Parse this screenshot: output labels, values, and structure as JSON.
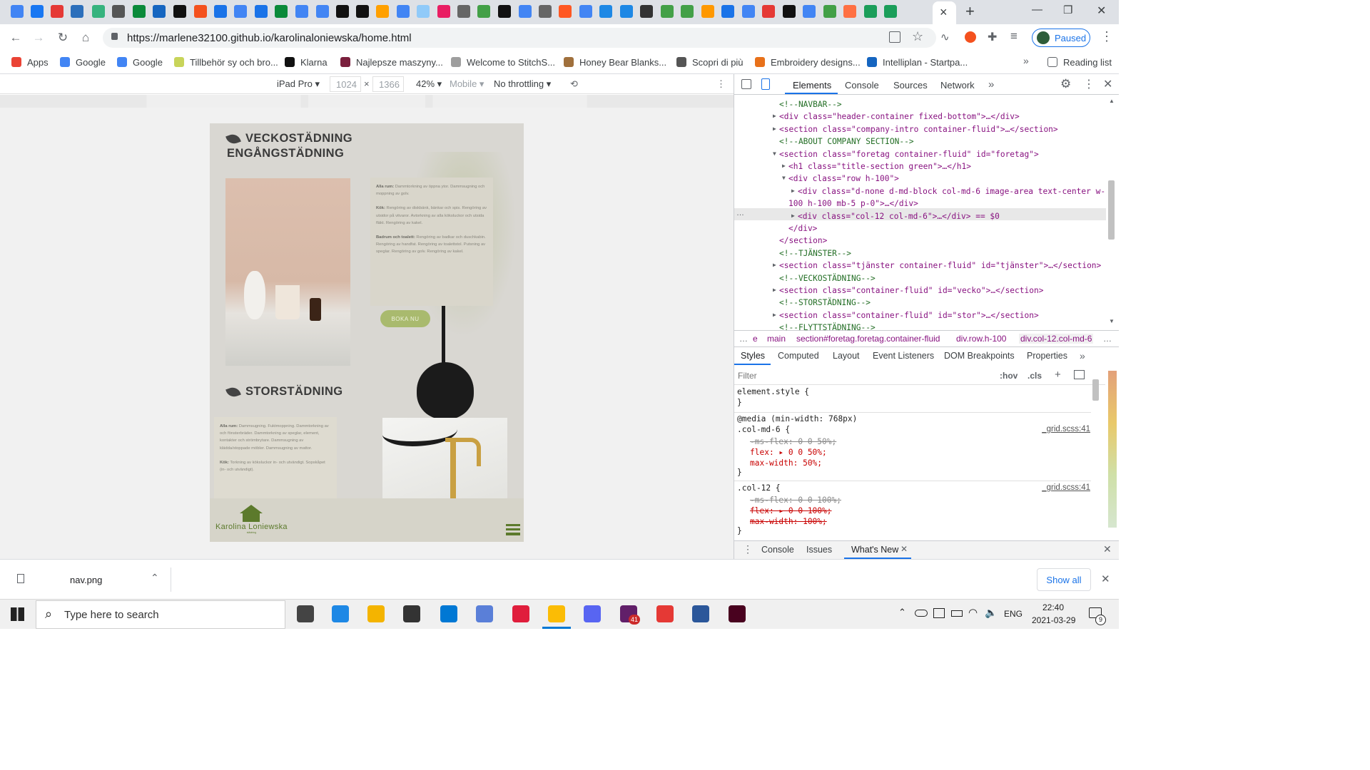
{
  "browser": {
    "active_tab_close": "×",
    "new_tab": "+",
    "url": "https://marlene32100.github.io/karolinaloniewska/home.html",
    "profile_label": "Paused",
    "window_controls": {
      "minimize": "—",
      "maximize": "❐",
      "close": "✕"
    }
  },
  "bookmarks": {
    "items": [
      {
        "label": "Apps",
        "color": "#ea4335"
      },
      {
        "label": "Google",
        "color": "#4285f4"
      },
      {
        "label": "Google",
        "color": "#4285f4"
      },
      {
        "label": "Tillbehör sy och bro...",
        "color": "#c8d45a"
      },
      {
        "label": "Klarna",
        "color": "#111111"
      },
      {
        "label": "Najlepsze maszyny...",
        "color": "#7a1f3d"
      },
      {
        "label": "Welcome to StitchS...",
        "color": "#9e9e9e"
      },
      {
        "label": "Honey Bear Blanks...",
        "color": "#a0703c"
      },
      {
        "label": "Scopri di più",
        "color": "#555555"
      },
      {
        "label": "Embroidery designs...",
        "color": "#e8711a"
      },
      {
        "label": "Intelliplan - Startpa...",
        "color": "#1565c0"
      }
    ],
    "overflow": "»",
    "reading_list": "Reading list"
  },
  "device_toolbar": {
    "device": "iPad Pro",
    "width": "1024",
    "height": "1366",
    "times": "×",
    "zoom": "42%",
    "mobile": "Mobile",
    "throttling": "No throttling"
  },
  "site": {
    "section1_title_1": "VECKOSTÄDNING",
    "section1_title_2": "ENGÅNGSTÄDNING",
    "card1_lines": [
      {
        "bold": "Alla rum:",
        "text": " Dammtorkning av öppna ytor. Dammsugning och moppning av golv."
      },
      {
        "bold": "",
        "text": ""
      },
      {
        "bold": "Kök:",
        "text": " Rengöring av diskbänk, bänkar och spis. Rengöring av utsidor på vitvaror. Avtorkning av alla köksluckor och utsida fläkt. Rengöring av kakel."
      },
      {
        "bold": "",
        "text": ""
      },
      {
        "bold": "Badrum och toalett:",
        "text": " Rengöring av badkar och duschkabin. Rengöring av handfat. Rengöring av toalettstol. Putsning av speglar. Rengöring av golv. Rengöring av kakel."
      }
    ],
    "book_button": "BOKA NU",
    "section2_title": "STORSTÄDNING",
    "card2_lines": [
      {
        "bold": "Alla rum:",
        "text": " Dammsugning. Fuktmoppning. Dammtorkning av och fönsterbräder. Dammtorkning av speglar, element, kontakter och strömbrytare. Dammsugning av klädda/stoppade möbler. Dammsugning av mattor."
      },
      {
        "bold": "",
        "text": ""
      },
      {
        "bold": "Kök:",
        "text": " Torkning av köksluckor in- och utvändigt. Sopskåpet (in- och utvändigt)."
      }
    ],
    "brand_name": "Karolina Loniewska",
    "brand_sub": "städning",
    "accent_green": "#9db05a",
    "dark_green": "#5c7a2c"
  },
  "devtools": {
    "tabs": [
      "Elements",
      "Console",
      "Sources",
      "Network"
    ],
    "more": "»",
    "code_lines": [
      "<!--NAVBAR-->",
      "<div class=\"header-container fixed-bottom\">…</div>",
      "<section class=\"company-intro container-fluid\">…</section>",
      "<!--ABOUT COMPANY SECTION-->",
      "<section class=\"foretag container-fluid\" id=\"foretag\">",
      "<h1 class=\"title-section green\">…</h1>",
      "<div class=\"row h-100\">",
      "<div class=\"d-none d-md-block col-md-6 image-area text-center w-",
      "100 h-100 mb-5 p-0\">…</div>",
      "<div class=\"col-12 col-md-6\">…</div> == $0",
      "</div>",
      "</section>",
      "<!--TJÄNSTER-->",
      "<section class=\"tjänster container-fluid\" id=\"tjänster\">…</section>",
      "<!--VECKOSTÄDNING-->",
      "<section class=\"container-fluid\" id=\"vecko\">…</section>",
      "<!--STORSTÄDNING-->",
      "<section class=\"container-fluid\" id=\"stor\">…</section>",
      "<!--FLYTTSTÄDNING-->"
    ],
    "breadcrumbs": [
      "…",
      "e",
      "main",
      "section#foretag.foretag.container-fluid",
      "div.row.h-100",
      "div.col-12.col-md-6",
      "…"
    ],
    "style_tabs": [
      "Styles",
      "Computed",
      "Layout",
      "Event Listeners",
      "DOM Breakpoints",
      "Properties"
    ],
    "filter_placeholder": "Filter",
    "hov": ":hov",
    "cls": ".cls",
    "styles": {
      "element_style": "element.style {",
      "close_brace": "}",
      "media": "@media (min-width: 768px)",
      "rule1_selector": ".col-md-6 {",
      "rule1_source": "_grid.scss:41",
      "rule1_props": [
        "-ms-flex: 0 0 50%;",
        "flex: ▸ 0 0 50%;",
        "max-width: 50%;"
      ],
      "rule2_selector": ".col-12 {",
      "rule2_source": "_grid.scss:41",
      "rule2_props": [
        "-ms-flex: 0 0 100%;",
        "flex: ▸ 0 0 100%;",
        "max-width: 100%;"
      ]
    },
    "drawer_tabs": [
      "Console",
      "Issues",
      "What's New"
    ]
  },
  "download_bar": {
    "file": "nav.png",
    "show_all": "Show all"
  },
  "taskbar": {
    "search_placeholder": "Type here to search",
    "language": "ENG",
    "time": "22:40",
    "date": "2021-03-29",
    "notification_count": "9",
    "slack_badge": "41"
  }
}
